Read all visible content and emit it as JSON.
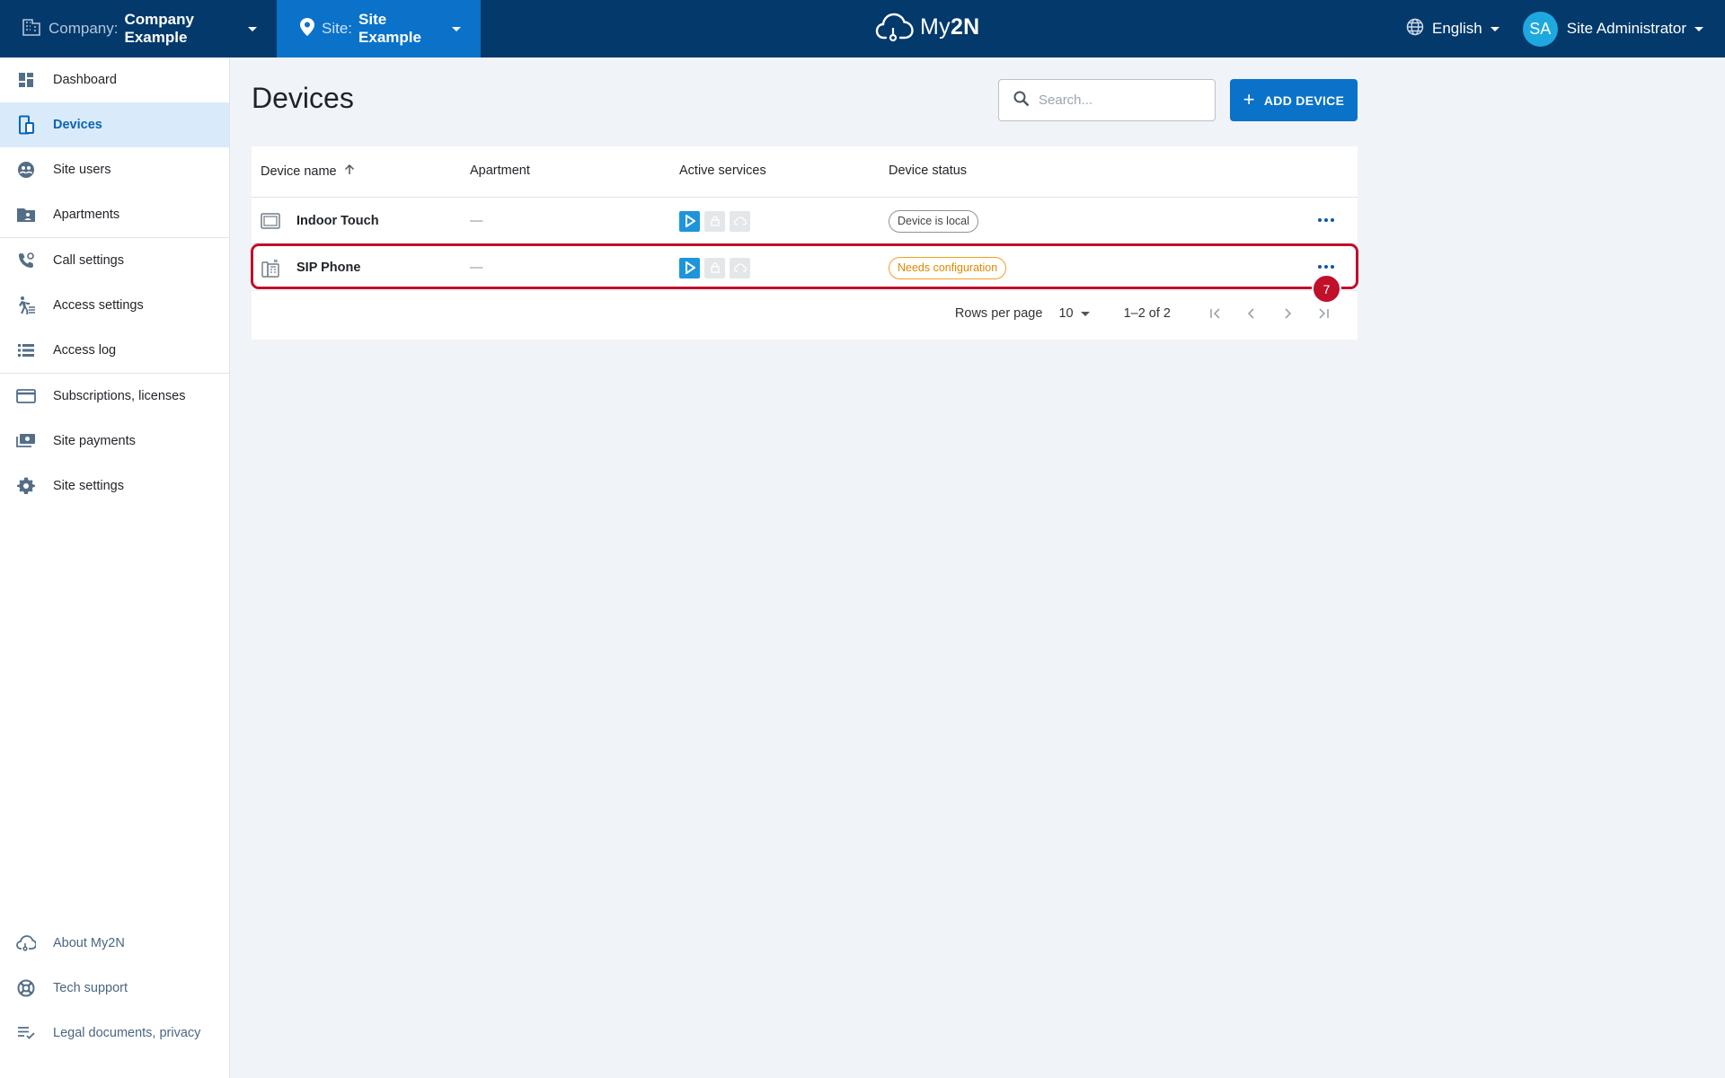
{
  "topbar": {
    "company_label": "Company:",
    "company_value": "Company Example",
    "site_label": "Site:",
    "site_value": "Site Example",
    "logo_text": "My",
    "logo_text_bold": "2N",
    "language": "English",
    "user_initials": "SA",
    "user_name": "Site Administrator"
  },
  "sidebar": {
    "items": [
      {
        "label": "Dashboard",
        "icon": "dashboard-icon"
      },
      {
        "label": "Devices",
        "icon": "devices-icon",
        "active": true
      },
      {
        "label": "Site users",
        "icon": "users-icon"
      },
      {
        "label": "Apartments",
        "icon": "apartments-icon"
      },
      {
        "label": "Call settings",
        "icon": "call-settings-icon"
      },
      {
        "label": "Access settings",
        "icon": "access-settings-icon"
      },
      {
        "label": "Access log",
        "icon": "access-log-icon"
      },
      {
        "label": "Subscriptions, licenses",
        "icon": "card-icon"
      },
      {
        "label": "Site payments",
        "icon": "payments-icon"
      },
      {
        "label": "Site settings",
        "icon": "gear-icon"
      }
    ],
    "bottom": [
      {
        "label": "About My2N",
        "icon": "cloud-icon"
      },
      {
        "label": "Tech support",
        "icon": "lifebuoy-icon"
      },
      {
        "label": "Legal documents, privacy",
        "icon": "list-check-icon"
      }
    ]
  },
  "main": {
    "title": "Devices",
    "search_placeholder": "Search...",
    "add_button": "ADD DEVICE",
    "table": {
      "columns": [
        "Device name",
        "Apartment",
        "Active services",
        "Device status"
      ],
      "rows": [
        {
          "name": "Indoor Touch",
          "apartment": "—",
          "status": "Device is local",
          "status_type": "local"
        },
        {
          "name": "SIP Phone",
          "apartment": "—",
          "status": "Needs configuration",
          "status_type": "warning"
        }
      ]
    },
    "pagination": {
      "rows_per_page_label": "Rows per page",
      "rows_per_page_value": "10",
      "range": "1–2 of 2"
    },
    "step_badge": "7"
  },
  "colors": {
    "topbar": "#03396b",
    "site_selector": "#0a72c9",
    "accent": "#0a72c9",
    "highlight": "#c0102a",
    "warning": "#f0a020"
  }
}
